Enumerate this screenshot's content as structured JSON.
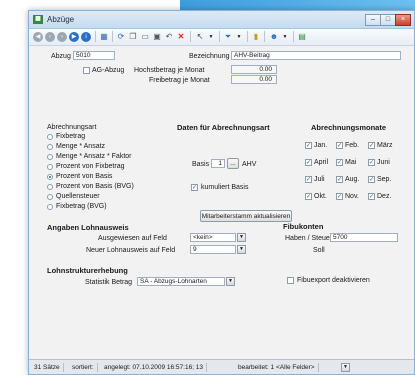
{
  "window": {
    "title": "Abzüge",
    "app_icon": "table-grid-icon"
  },
  "toolbar": {
    "icons": [
      "first-record-icon",
      "prev-record-icon",
      "next-record-icon",
      "last-record-icon",
      "info-icon",
      "grid-icon",
      "refresh-icon",
      "copy-icon",
      "paste-icon",
      "save-icon",
      "undo-icon",
      "delete-icon",
      "cursor-icon",
      "filter-icon",
      "bookmark-icon",
      "user-icon",
      "export-icon"
    ]
  },
  "header": {
    "abzug_label": "Abzug",
    "abzug_value": "5010",
    "bezeichnung_label": "Bezeichnung",
    "bezeichnung_value": "AHV-Beitrag",
    "ag_abzug_label": "AG-Abzug",
    "hochstbetrag_label": "Hochstbetrag je Monat",
    "hochstbetrag_value": "0.00",
    "freibetrag_label": "Freibetrag je Monat",
    "freibetrag_value": "0.00"
  },
  "abrechnungsart": {
    "label": "Abrechnungsart",
    "options": [
      "Fixbetrag",
      "Menge * Ansatz",
      "Menge * Ansatz * Faktor",
      "Prozent von Fixbetrag",
      "Prozent von Basis",
      "Prozent von Basis (BVG)",
      "Quellensteuer",
      "Fixbetrag (BVG)"
    ],
    "selected_index": 4
  },
  "daten": {
    "heading": "Daten für Abrechnungsart",
    "basis_label": "Basis",
    "basis_value": "1",
    "basis_button": "...",
    "basis_text": "AHV",
    "kumuliert_label": "kumuliert Basis",
    "aktualisieren_button": "Mitarbeiterstamm aktualisieren"
  },
  "abrechnungsmonate": {
    "heading": "Abrechnungsmonate",
    "months": [
      "Jan.",
      "Feb.",
      "März",
      "April",
      "Mai",
      "Juni",
      "Juli",
      "Aug.",
      "Sep.",
      "Okt.",
      "Nov.",
      "Dez."
    ],
    "check_mark": "✓"
  },
  "lohnausweis": {
    "heading": "Angaben Lohnausweis",
    "ausgewiesen_label": "Ausgewiesen auf Feld",
    "ausgewiesen_value": "<kein>",
    "neuer_label": "Neuer Lohnausweis auf Feld",
    "neuer_value": "9"
  },
  "fibukonten": {
    "heading": "Fibukonten",
    "haben_label": "Haben / Steuer",
    "haben_value": "5700",
    "soll_label": "Soll",
    "soll_value": "",
    "fibuexport_label": "Fibuexport deaktivieren"
  },
  "lohnstruktur": {
    "heading": "Lohnstrukturerhebung",
    "statistik_label": "Statistik Betrag",
    "statistik_value": "SA - Abzugs-Lohnarten"
  },
  "statusbar": {
    "saetze": "31 Sätze",
    "sortiert": "sortiert:",
    "angelegt": "angelegt: 07.10.2009 16:57:16; 13",
    "bearbeitet": "bearbeitet: 1 <Alle Felder>"
  },
  "colors": {
    "accent": "#2a82cc",
    "window_bg": "#f2f2f2"
  }
}
